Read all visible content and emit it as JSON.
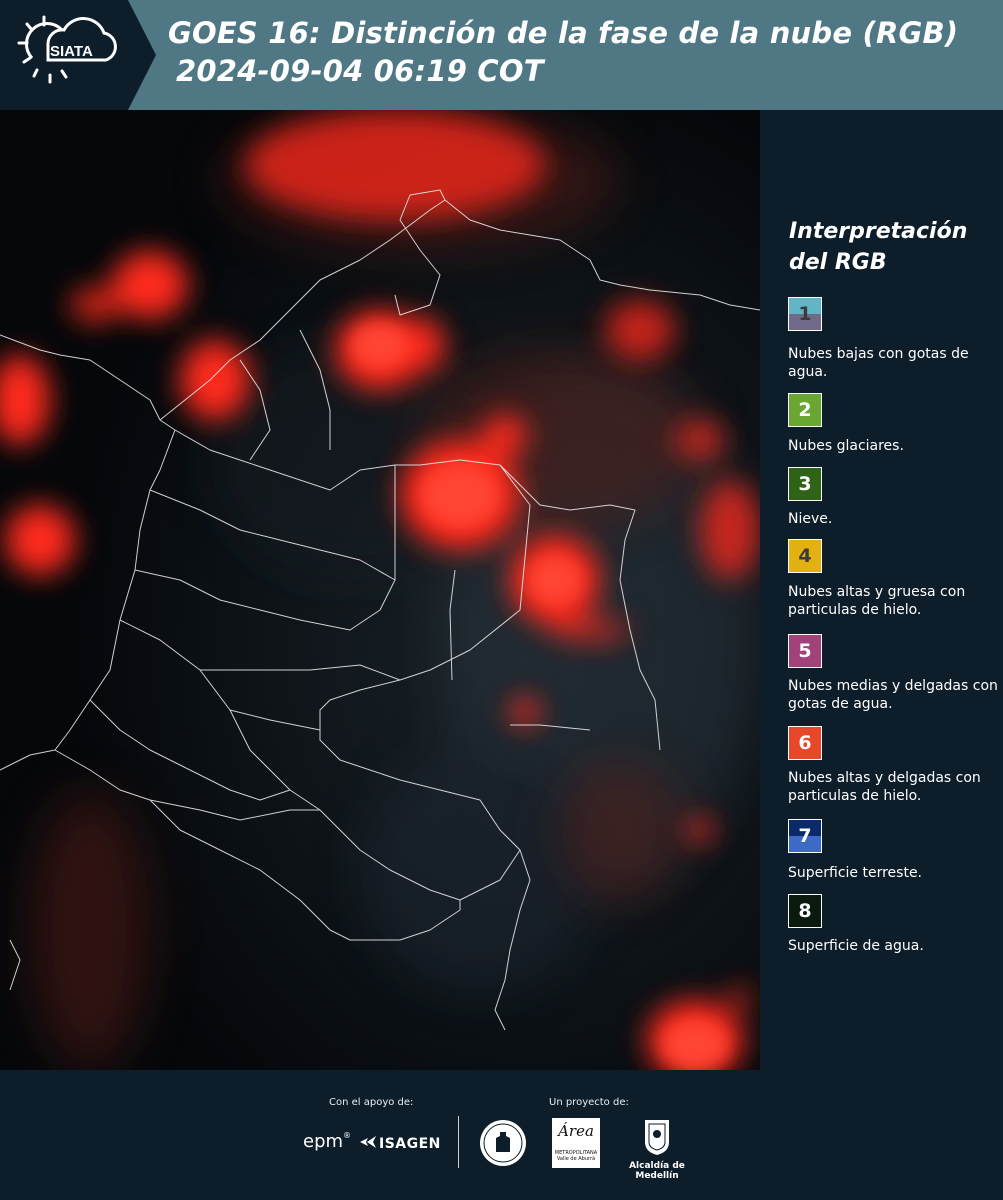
{
  "header": {
    "logo_text": "SIATA",
    "title_line1": "GOES 16: Distinción de la fase de la nube (RGB)",
    "title_line2": "2024-09-04 06:19 COT"
  },
  "map": {
    "icon": "satellite-rgb-cloud-phase-image"
  },
  "legend": {
    "title_line1": "Interpretación",
    "title_line2": "del RGB",
    "items": [
      {
        "num": "1",
        "label": "Nubes bajas con gotas de agua.",
        "color_top": "#61b5c4",
        "color_bottom": "#6f6b88",
        "num_color": "#3a3a3a"
      },
      {
        "num": "2",
        "label": "Nubes glaciares.",
        "color": "#6aa732",
        "num_color": "#ffffff"
      },
      {
        "num": "3",
        "label": "Nieve.",
        "color": "#2f6418",
        "num_color": "#ffffff"
      },
      {
        "num": "4",
        "label": "Nubes altas y gruesa con particulas de hielo.",
        "color": "#e4b112",
        "num_color": "#3a3a3a"
      },
      {
        "num": "5",
        "label": "Nubes medias y delgadas con gotas de agua.",
        "color": "#a2427a",
        "num_color": "#ffffff"
      },
      {
        "num": "6",
        "label": "Nubes altas y delgadas con particulas de hielo.",
        "color": "#e8482a",
        "num_color": "#ffffff"
      },
      {
        "num": "7",
        "label": "Superficie terreste.",
        "color_top": "#0b2a6a",
        "color_bottom": "#3d6ac4",
        "num_color": "#ffffff"
      },
      {
        "num": "8",
        "label": "Superficie de agua.",
        "color": "#0a1a0f",
        "num_color": "#ffffff"
      }
    ]
  },
  "footer": {
    "support_label": "Con el apoyo de:",
    "project_label": "Un proyecto de:",
    "logos": {
      "epm": "epm",
      "isagen": "ISAGEN",
      "area_metro": "Área",
      "area_metro_sub": "METROPOLITANA",
      "area_metro_sub2": "Valle de Aburrá",
      "alcaldia": "Alcaldía de Medellín"
    }
  }
}
